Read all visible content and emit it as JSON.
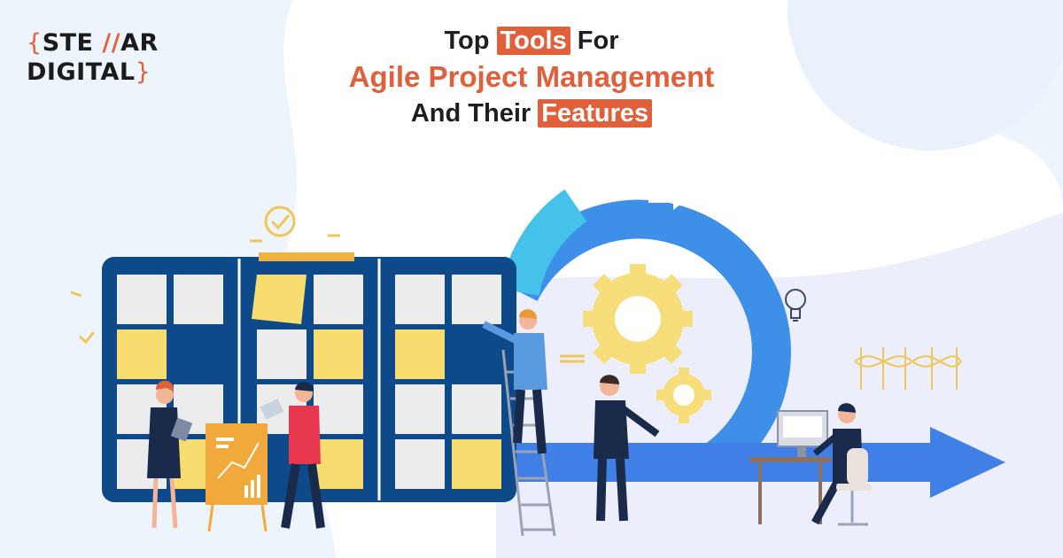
{
  "logo": {
    "text_line1_a": "STE",
    "text_line1_slash": "//",
    "text_line1_b": "AR",
    "text_line2": "DIGITAL",
    "brace_open": "{",
    "brace_close": "}"
  },
  "headline": {
    "line1_a": "Top",
    "line1_highlight": "Tools",
    "line1_b": "For",
    "line2": "Agile Project Management",
    "line3_a": "And Their",
    "line3_highlight": "Features"
  },
  "colors": {
    "accent": "#e0603b",
    "board_navy": "#0e4a8a",
    "sticky_yellow": "#f7dc6f",
    "ring_blue": "#3d8fe8",
    "gear_yellow": "#f7de7a"
  },
  "icons": [
    "check-icon",
    "sync-arrows-icon",
    "lightbulb-icon",
    "gear-icon",
    "dna-wave-icon"
  ]
}
